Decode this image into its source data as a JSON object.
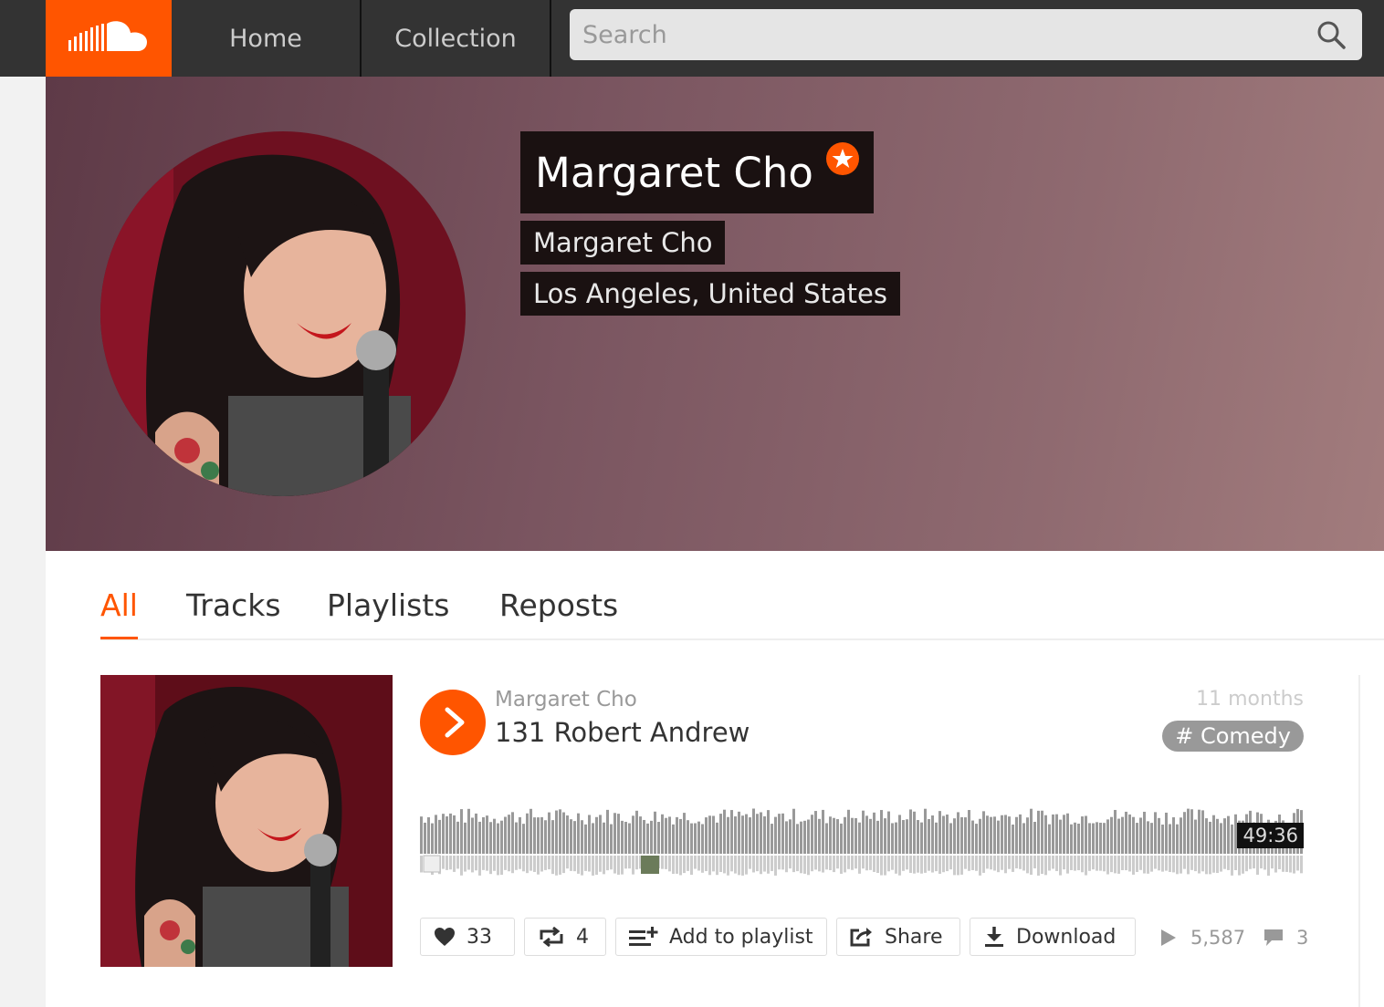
{
  "nav": {
    "home": "Home",
    "collection": "Collection",
    "search_placeholder": "Search"
  },
  "profile": {
    "name": "Margaret Cho",
    "full_name": "Margaret Cho",
    "location": "Los Angeles, United States"
  },
  "tabs": [
    "All",
    "Tracks",
    "Playlists",
    "Reposts"
  ],
  "track": {
    "uploader": "Margaret Cho",
    "title": "131 Robert Andrew",
    "posted": "11 months",
    "genre": "# Comedy",
    "duration": "49:36",
    "likes": "33",
    "reposts": "4",
    "add_to_playlist": "Add to playlist",
    "share": "Share",
    "download": "Download",
    "plays": "5,587",
    "comments": "3"
  },
  "colors": {
    "accent": "#ff5500",
    "topbar": "#333333"
  }
}
